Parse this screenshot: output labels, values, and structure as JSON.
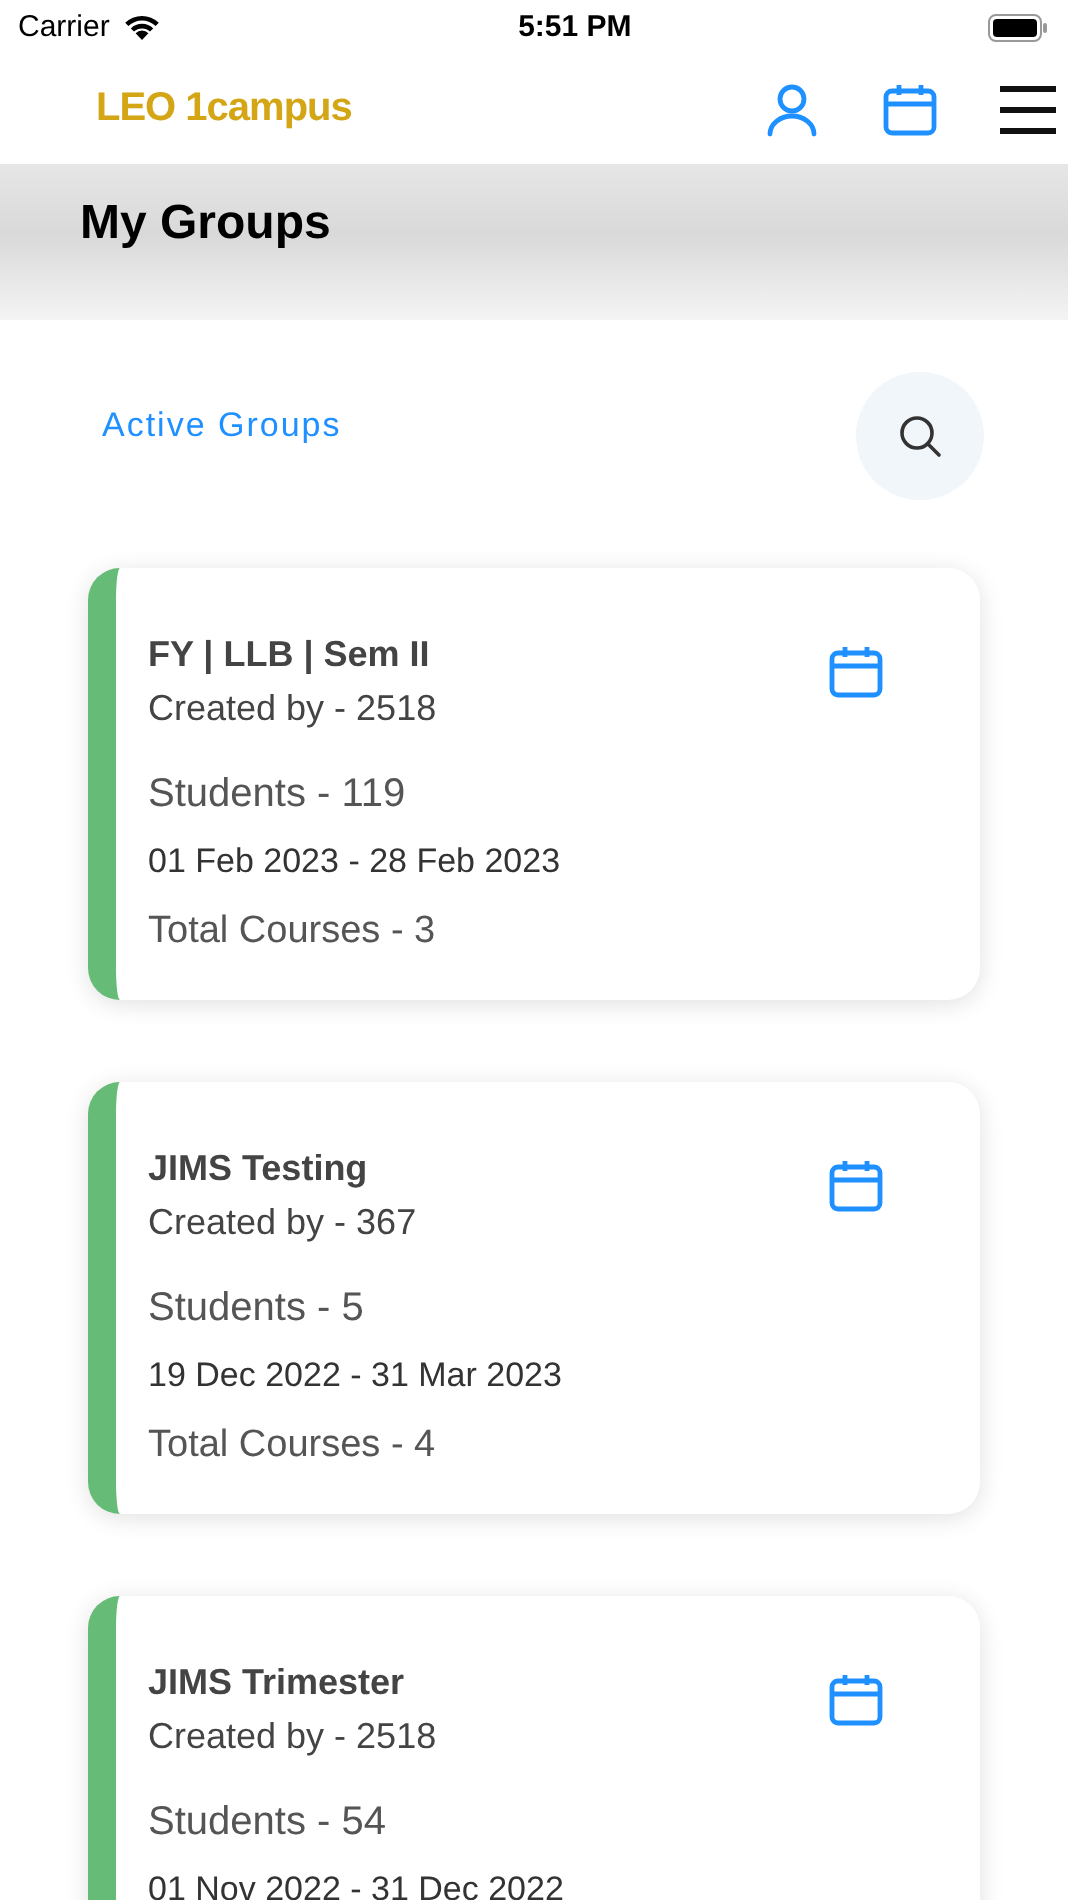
{
  "status_bar": {
    "carrier": "Carrier",
    "time": "5:51 PM"
  },
  "header": {
    "logo": "LEO 1campus"
  },
  "page_title": "My Groups",
  "section": {
    "label": "Active Groups"
  },
  "groups": [
    {
      "name": "FY | LLB | Sem II",
      "created_by": "Created by - 2518",
      "students": "Students - 119",
      "dates": "01 Feb 2023 - 28 Feb 2023",
      "courses": "Total Courses - 3",
      "color": "#66bb77"
    },
    {
      "name": "JIMS Testing",
      "created_by": "Created by - 367",
      "students": "Students - 5",
      "dates": "19 Dec 2022 - 31 Mar 2023",
      "courses": "Total Courses - 4",
      "color": "#66bb77"
    },
    {
      "name": "JIMS Trimester",
      "created_by": "Created by - 2518",
      "students": "Students - 54",
      "dates": "01 Nov 2022 - 31 Dec 2022",
      "color": "#66bb77"
    }
  ]
}
